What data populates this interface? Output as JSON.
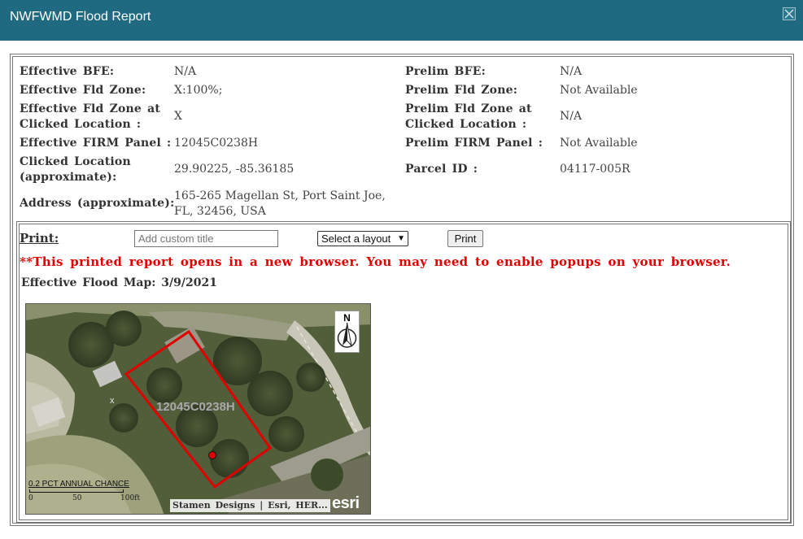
{
  "dialog": {
    "title": "NWFWMD Flood Report"
  },
  "info": {
    "left": [
      {
        "label": "Effective BFE:",
        "value": "N/A"
      },
      {
        "label": "Effective Fld Zone:",
        "value": "X:100%;"
      },
      {
        "label_line1": "Effective Fld Zone at",
        "label_line2": "Clicked Location :",
        "value": "X"
      },
      {
        "label": "Effective FIRM Panel :",
        "value": "12045C0238H"
      },
      {
        "label_line1": "Clicked Location",
        "label_line2": "(approximate):",
        "value": "29.90225, -85.36185"
      },
      {
        "label": "Address (approximate):",
        "value_line1": "165-265 Magellan St, Port Saint Joe,",
        "value_line2": "FL, 32456, USA"
      }
    ],
    "right": [
      {
        "label": "Prelim BFE:",
        "value": "N/A"
      },
      {
        "label": "Prelim Fld Zone:",
        "value": "Not Available"
      },
      {
        "label_line1": "Prelim Fld Zone at",
        "label_line2": "Clicked Location :",
        "value": "N/A"
      },
      {
        "label": "Prelim FIRM Panel :",
        "value": "Not Available"
      },
      {
        "label": "Parcel ID :",
        "value": "04117-005R"
      }
    ]
  },
  "print": {
    "label": "Print:",
    "title_placeholder": "Add custom title",
    "layout_selected": "Select a layout",
    "button_label": "Print",
    "warning": "**This printed report opens in a new browser. You may need to enable popups on your browser.",
    "map_caption": "Effective Flood Map: 3/9/2021"
  },
  "map": {
    "north_label": "N",
    "panel_label": "12045C0238H",
    "scale_title": "0.2 PCT ANNUAL CHANCE",
    "scale_ticks": [
      "0",
      "50",
      "100ft"
    ],
    "attribution": "Stamen Designs | Esri, HER...",
    "logo": "esri",
    "parcel_color": "#e00000"
  },
  "colors": {
    "titlebar": "#1f6a80",
    "warning": "#e00000"
  }
}
